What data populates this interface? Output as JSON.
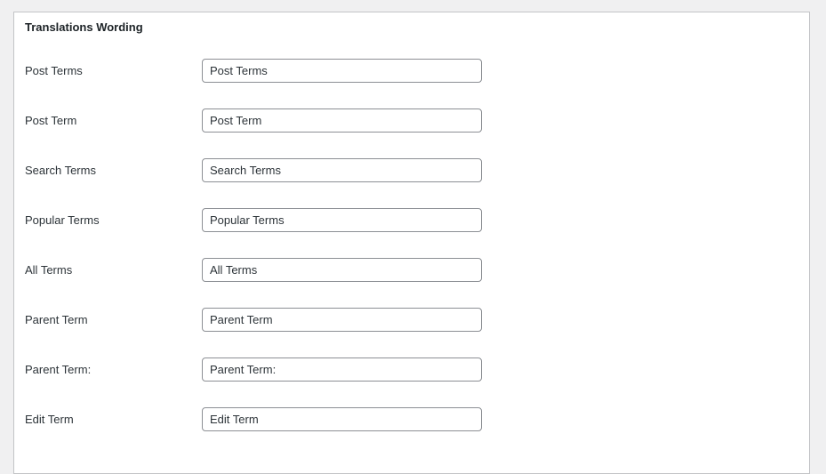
{
  "section": {
    "title": "Translations Wording",
    "fields": [
      {
        "label": "Post Terms",
        "value": "Post Terms"
      },
      {
        "label": "Post Term",
        "value": "Post Term"
      },
      {
        "label": "Search Terms",
        "value": "Search Terms"
      },
      {
        "label": "Popular Terms",
        "value": "Popular Terms"
      },
      {
        "label": "All Terms",
        "value": "All Terms"
      },
      {
        "label": "Parent Term",
        "value": "Parent Term"
      },
      {
        "label": "Parent Term:",
        "value": "Parent Term:"
      },
      {
        "label": "Edit Term",
        "value": "Edit Term"
      }
    ]
  }
}
